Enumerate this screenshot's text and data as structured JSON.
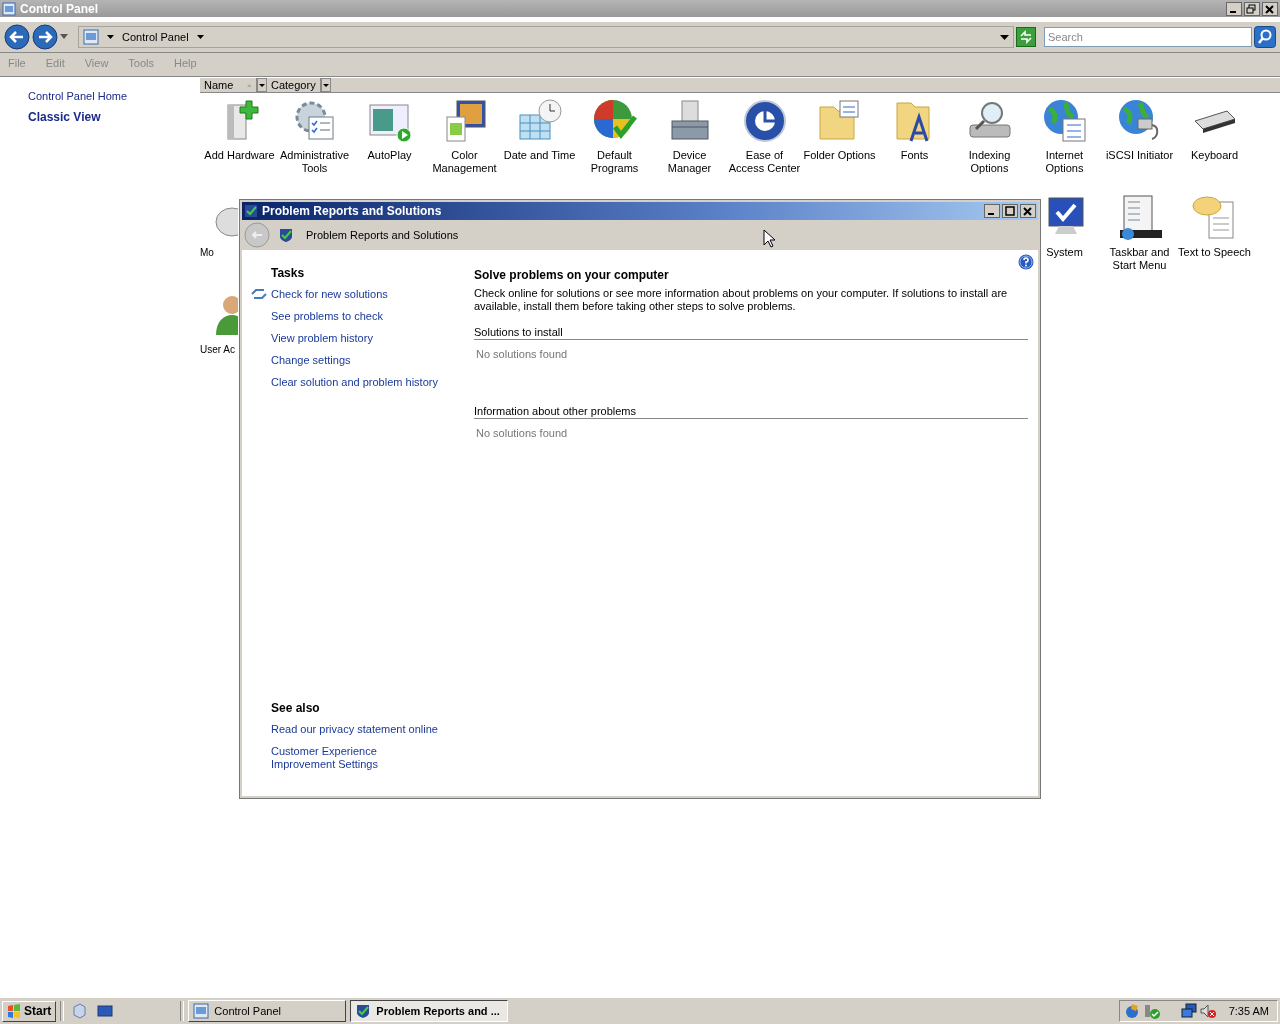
{
  "window": {
    "title": "Control Panel"
  },
  "address_bar": {
    "path": "Control Panel"
  },
  "search": {
    "placeholder": "Search"
  },
  "menu": [
    "File",
    "Edit",
    "View",
    "Tools",
    "Help"
  ],
  "sidebar": {
    "items": [
      {
        "label": "Control Panel Home",
        "selected": false
      },
      {
        "label": "Classic View",
        "selected": true
      }
    ]
  },
  "columns": [
    {
      "label": "Name",
      "sorted": true
    },
    {
      "label": "Category",
      "sorted": false
    }
  ],
  "icon_rows": [
    {
      "left": [
        {
          "label": "Add Hardware"
        },
        {
          "label": "Administrative Tools"
        },
        {
          "label": "AutoPlay"
        },
        {
          "label": "Color Management"
        },
        {
          "label": "Date and Time"
        },
        {
          "label": "Default Programs"
        },
        {
          "label": "Device Manager"
        },
        {
          "label": "Ease of Access Center"
        },
        {
          "label": "Folder Options"
        },
        {
          "label": "Fonts"
        },
        {
          "label": "Indexing Options"
        },
        {
          "label": "Internet Options"
        },
        {
          "label": "iSCSI Initiator"
        },
        {
          "label": "Keyboard"
        }
      ],
      "right": []
    },
    {
      "left": [
        {
          "label": "Mo",
          "kind": "partial"
        }
      ],
      "right": [
        {
          "label": "System"
        },
        {
          "label": "Taskbar and Start Menu"
        },
        {
          "label": "Text to Speech"
        }
      ]
    },
    {
      "left": [
        {
          "label": "User Ac",
          "kind": "partial"
        }
      ],
      "right": []
    }
  ],
  "dialog": {
    "title": "Problem Reports and Solutions",
    "location": "Problem Reports and Solutions",
    "tasks_heading": "Tasks",
    "tasks": [
      {
        "label": "Check for new solutions",
        "kind": "icon"
      },
      {
        "label": "See problems to check",
        "kind": "plain"
      },
      {
        "label": "View problem history",
        "kind": "plain"
      },
      {
        "label": "Change settings",
        "kind": "plain"
      },
      {
        "label": "Clear solution and problem history",
        "kind": "plain"
      }
    ],
    "see_also_heading": "See also",
    "see_also": [
      "Read our privacy statement online",
      "Customer Experience Improvement Settings"
    ],
    "heading": "Solve problems on your computer",
    "description": "Check online for solutions or see more information about problems on your computer. If solutions to install are available, install them before taking other steps to solve problems.",
    "sections": [
      {
        "title": "Solutions to install",
        "empty_text": "No solutions found"
      },
      {
        "title": "Information about other problems",
        "empty_text": "No solutions found"
      }
    ]
  },
  "taskbar": {
    "start": "Start",
    "tasks": [
      {
        "label": "Control Panel",
        "selected": false
      },
      {
        "label": "Problem Reports and ...",
        "selected": true
      }
    ],
    "clock": "7:35 AM"
  }
}
